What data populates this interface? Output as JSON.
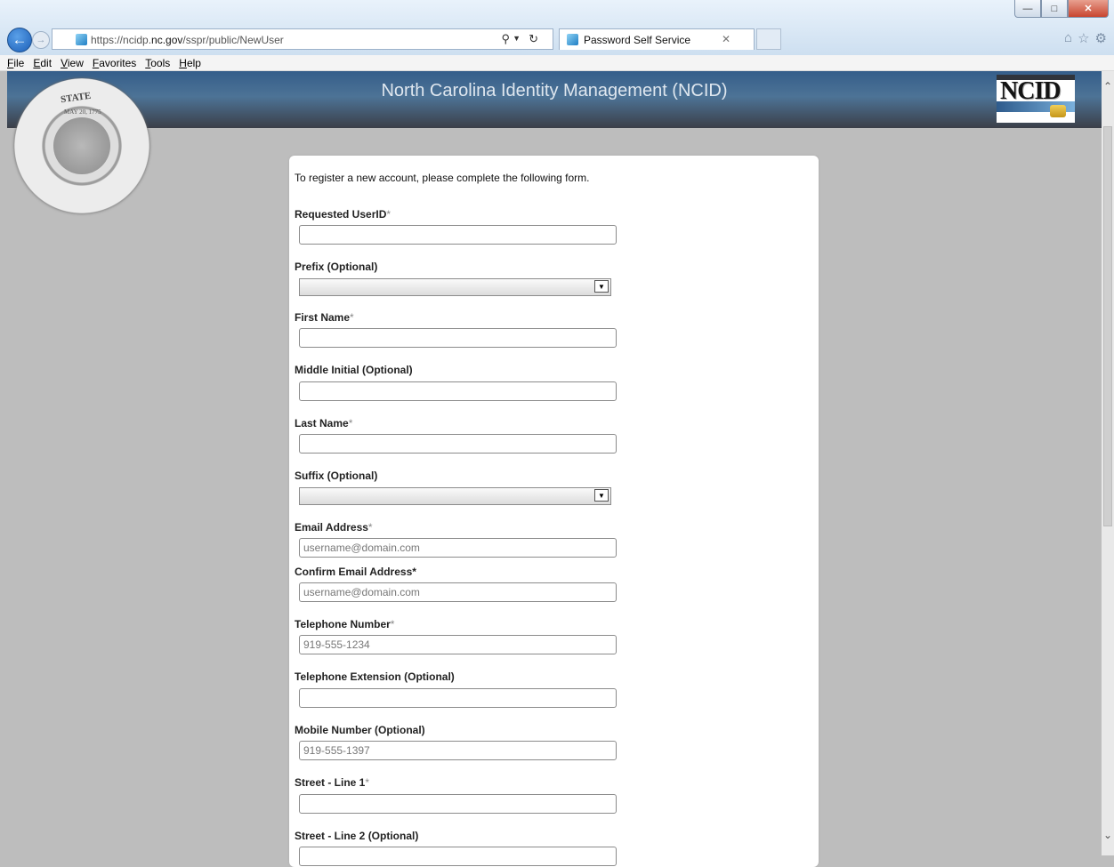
{
  "browser": {
    "address": {
      "prefix": "https://ncidp.",
      "domain": "nc.gov",
      "path": "/sspr/public/NewUser"
    },
    "tab_title": "Password Self Service",
    "menu": [
      "File",
      "Edit",
      "View",
      "Favorites",
      "Tools",
      "Help"
    ]
  },
  "header": {
    "title": "North Carolina Identity Management (NCID)",
    "logo_text": "NCID"
  },
  "seal": {
    "text": "STATE",
    "date": "MAY 20, 1775"
  },
  "form": {
    "intro": "To register a new account, please complete the following form.",
    "required_marker": "*",
    "fields": {
      "userid": {
        "label": "Requested UserID",
        "value": ""
      },
      "prefix": {
        "label": "Prefix (Optional)",
        "selected": ""
      },
      "first_name": {
        "label": "First Name",
        "value": ""
      },
      "middle_initial": {
        "label": "Middle Initial (Optional)",
        "value": ""
      },
      "last_name": {
        "label": "Last Name",
        "value": ""
      },
      "suffix": {
        "label": "Suffix (Optional)",
        "selected": ""
      },
      "email": {
        "label": "Email Address",
        "placeholder": "username@domain.com"
      },
      "confirm_email": {
        "label": "Confirm Email Address*",
        "placeholder": "username@domain.com"
      },
      "telephone": {
        "label": "Telephone Number",
        "placeholder": "919-555-1234"
      },
      "telephone_ext": {
        "label": "Telephone Extension (Optional)",
        "value": ""
      },
      "mobile": {
        "label": "Mobile Number (Optional)",
        "placeholder": "919-555-1397"
      },
      "street1": {
        "label": "Street - Line 1",
        "value": ""
      },
      "street2": {
        "label": "Street - Line 2 (Optional)",
        "value": ""
      }
    }
  }
}
